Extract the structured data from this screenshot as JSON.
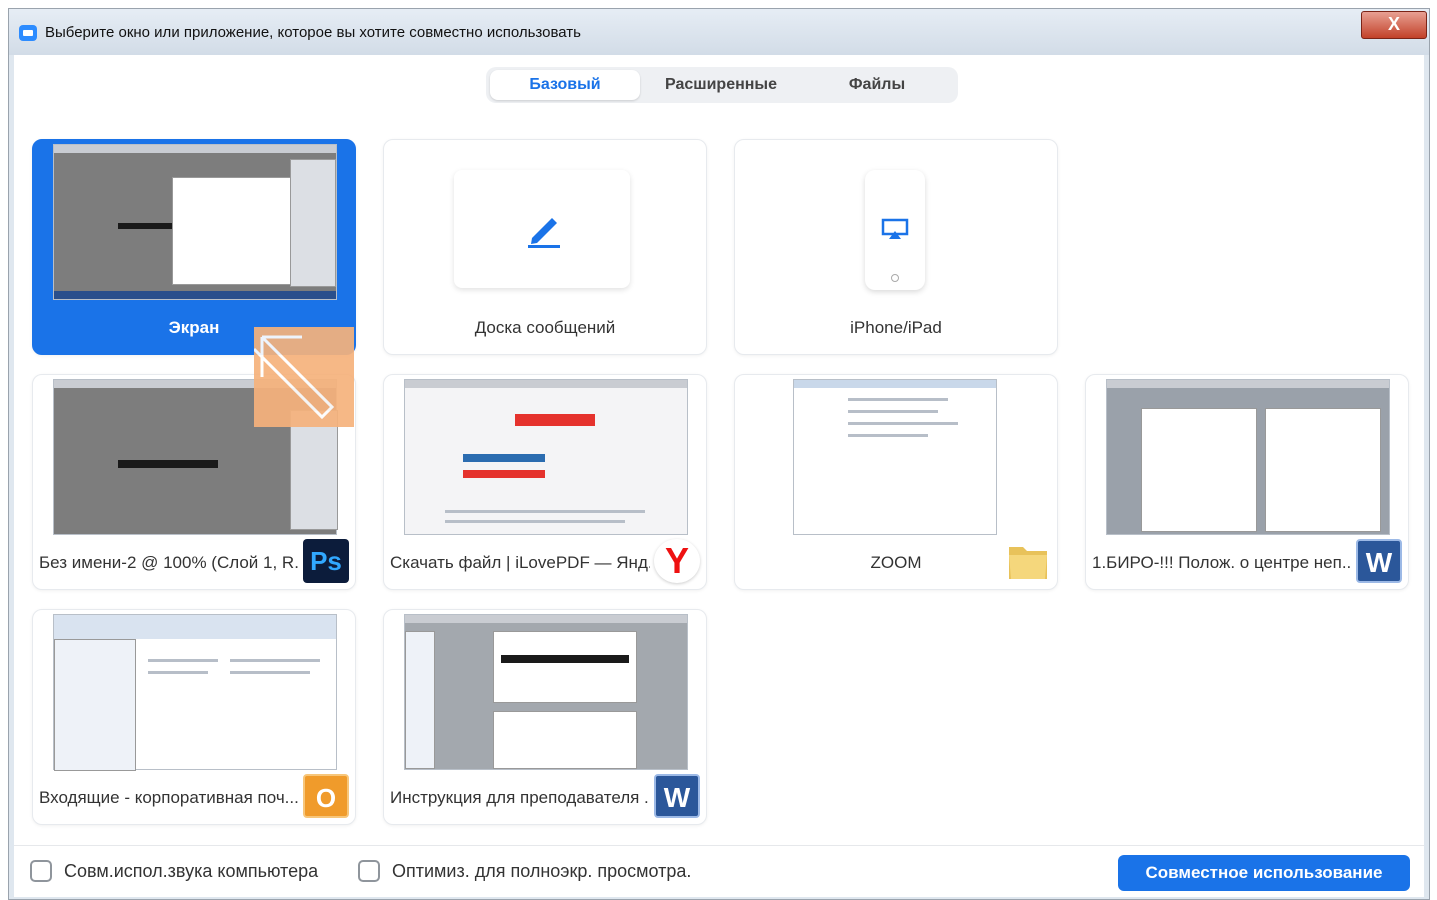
{
  "window": {
    "title": "Выберите окно или приложение, которое вы хотите совместно использовать",
    "close_label": "X"
  },
  "tabs": [
    {
      "label": "Базовый",
      "active": true
    },
    {
      "label": "Расширенные",
      "active": false
    },
    {
      "label": "Файлы",
      "active": false
    }
  ],
  "tiles": {
    "screen": {
      "label": "Экран",
      "selected": true
    },
    "whiteboard": {
      "label": "Доска сообщений",
      "icon": "pencil-icon"
    },
    "iphone": {
      "label": "iPhone/iPad",
      "icon": "airplay-icon"
    },
    "photoshop": {
      "label": "Без имени-2 @ 100% (Слой 1, R...",
      "badge": "Ps"
    },
    "ilovepdf": {
      "label": "Скачать файл | iLovePDF — Янд...",
      "badge": "Y"
    },
    "zoom_folder": {
      "label": "ZOOM",
      "icon": "folder-icon"
    },
    "word_doc1": {
      "label": "1.БИРО-!!! Полож. о центре неп...",
      "badge": "W"
    },
    "outlook": {
      "label": "Входящие - корпоративная поч...",
      "badge": "O"
    },
    "word_doc2": {
      "label": "Инструкция для преподавателя ...",
      "badge": "W"
    }
  },
  "footer": {
    "computer_audio_label": "Совм.испол.звука компьютера",
    "optimize_label": "Оптимиз. для полноэкр. просмотра.",
    "share_button": "Совместное использование"
  },
  "colors": {
    "accent": "#1a73e8",
    "cursor_overlay": "#f6b27c",
    "close_button": "#c24129"
  }
}
